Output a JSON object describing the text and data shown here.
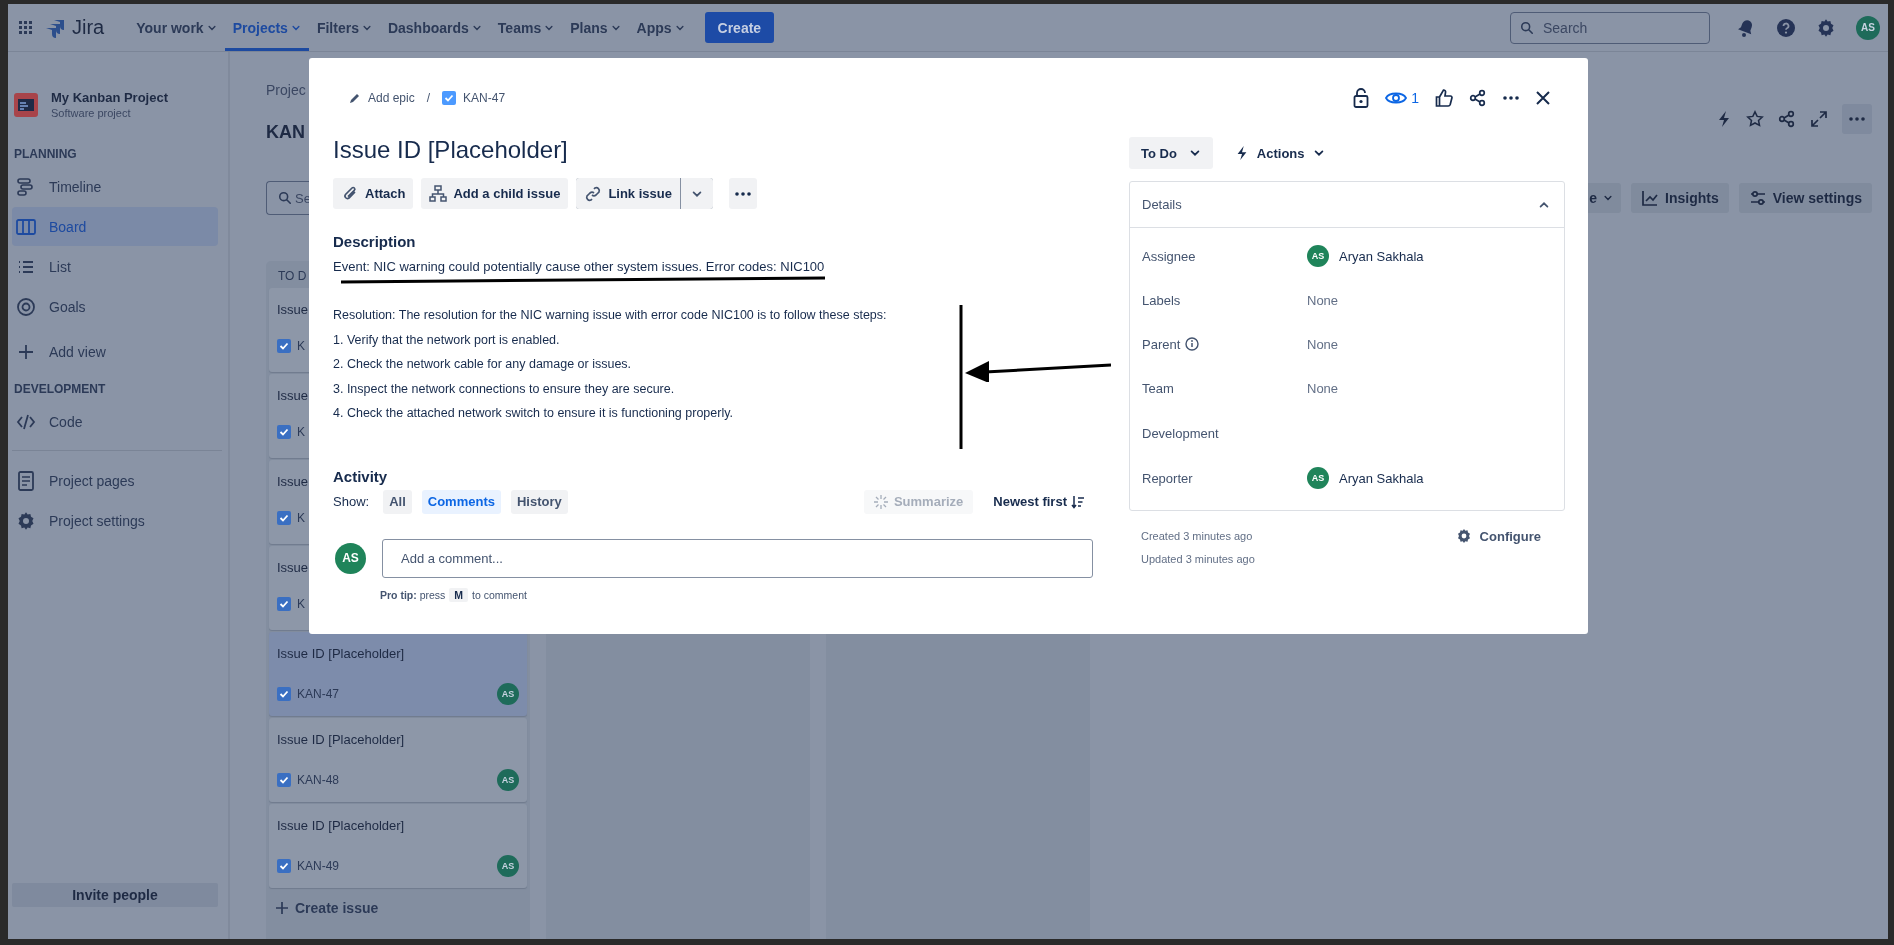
{
  "top_nav": {
    "app_name": "Jira",
    "items": [
      {
        "label": "Your work",
        "selected": false
      },
      {
        "label": "Projects",
        "selected": true
      },
      {
        "label": "Filters",
        "selected": false
      },
      {
        "label": "Dashboards",
        "selected": false
      },
      {
        "label": "Teams",
        "selected": false
      },
      {
        "label": "Plans",
        "selected": false
      },
      {
        "label": "Apps",
        "selected": false
      }
    ],
    "create_button": "Create",
    "search": {
      "placeholder": "Search"
    },
    "avatar": "AS"
  },
  "sidebar": {
    "project": {
      "name": "My Kanban Project",
      "subtitle": "Software project"
    },
    "sections": [
      {
        "heading": "PLANNING",
        "items": [
          {
            "label": "Timeline",
            "kind": "timeline",
            "selected": false
          },
          {
            "label": "Board",
            "kind": "board",
            "selected": true
          },
          {
            "label": "List",
            "kind": "list",
            "selected": false
          },
          {
            "label": "Goals",
            "kind": "goals",
            "selected": false
          },
          {
            "label": "Add view",
            "kind": "add",
            "selected": false
          }
        ]
      },
      {
        "heading": "DEVELOPMENT",
        "items": [
          {
            "label": "Code",
            "kind": "code",
            "selected": false
          }
        ]
      },
      {
        "items": [
          {
            "label": "Project pages",
            "kind": "pages",
            "selected": false
          },
          {
            "label": "Project settings",
            "kind": "settings",
            "selected": false
          }
        ]
      }
    ],
    "footer_button": "Invite people"
  },
  "board": {
    "breadcrumb": "Projec",
    "title": "KAN",
    "search": {
      "placeholder": "Se"
    },
    "toolbar": [
      {
        "label": "e",
        "kind": "dropdown"
      },
      {
        "label": "Insights",
        "kind": "insights"
      },
      {
        "label": "View settings",
        "kind": "settings"
      }
    ],
    "columns": [
      {
        "kind": "cards",
        "title": "TO D",
        "cards": [
          {
            "title": "Issue",
            "key": "K",
            "selected": false
          },
          {
            "title": "Issue",
            "key": "K",
            "selected": false
          },
          {
            "title": "Issue",
            "key": "K",
            "selected": false
          },
          {
            "title": "Issue",
            "key": "K",
            "selected": false
          },
          {
            "title": "Issue ID [Placeholder]",
            "key": "KAN-47",
            "avatar": "AS",
            "selected": true
          },
          {
            "title": "Issue ID [Placeholder]",
            "key": "KAN-48",
            "avatar": "AS",
            "selected": false
          },
          {
            "title": "Issue ID [Placeholder]",
            "key": "KAN-49",
            "avatar": "AS",
            "selected": false
          }
        ],
        "create_label": "Create issue"
      },
      {
        "kind": "blank"
      },
      {
        "kind": "blank"
      }
    ]
  },
  "issue_modal": {
    "breadcrumb": {
      "epic": "Add epic",
      "separator": "/",
      "key": "KAN-47"
    },
    "watchers": "1",
    "title": "Issue ID [Placeholder]",
    "actions": [
      {
        "label": "Attach",
        "kind": "attach"
      },
      {
        "label": "Add a child issue",
        "kind": "child"
      },
      {
        "label": "Link issue",
        "kind": "link"
      }
    ],
    "description": {
      "heading": "Description",
      "event": "Event: NIC warning could potentially cause other system issues. Error codes: NIC100",
      "resolution": "Resolution: The resolution for the NIC warning issue with error code NIC100 is to follow these steps:",
      "steps": [
        "1. Verify that the network port is enabled.",
        "2. Check the network cable for any damage or issues.",
        "3. Inspect the network connections to ensure they are secure.",
        "4. Check the attached network switch to ensure it is functioning properly."
      ]
    },
    "activity": {
      "heading": "Activity",
      "show_label": "Show:",
      "filters": [
        {
          "label": "All",
          "selected": false
        },
        {
          "label": "Comments",
          "selected": true
        },
        {
          "label": "History",
          "selected": false
        }
      ],
      "summarize": {
        "label": "Summarize",
        "disabled": true
      },
      "sort": "Newest first",
      "avatar": "AS",
      "comment": {
        "placeholder": "Add a comment..."
      },
      "pro_tip": {
        "text": "**Pro tip:** press",
        "key": "M",
        "after": "to comment"
      }
    },
    "status": "To Do",
    "actions_button": "Actions",
    "details": {
      "heading": "Details",
      "expanded": true,
      "fields": [
        {
          "label": "Assignee",
          "kind": "user",
          "value": "Aryan Sakhala",
          "avatar": "AS"
        },
        {
          "label": "Labels",
          "kind": "text",
          "value": "None"
        },
        {
          "label": "Parent",
          "kind": "text",
          "value": "None",
          "info": true
        },
        {
          "label": "Team",
          "kind": "text",
          "value": "None"
        },
        {
          "label": "Development",
          "kind": "empty"
        },
        {
          "label": "Reporter",
          "kind": "user",
          "value": "Aryan Sakhala",
          "avatar": "AS"
        }
      ]
    },
    "created": "Created 3 minutes ago",
    "updated": "Updated 3 minutes ago",
    "configure": "Configure",
    "annotations": [
      {
        "kind": "underline"
      },
      {
        "kind": "bracket-line"
      },
      {
        "kind": "arrow"
      }
    ]
  }
}
